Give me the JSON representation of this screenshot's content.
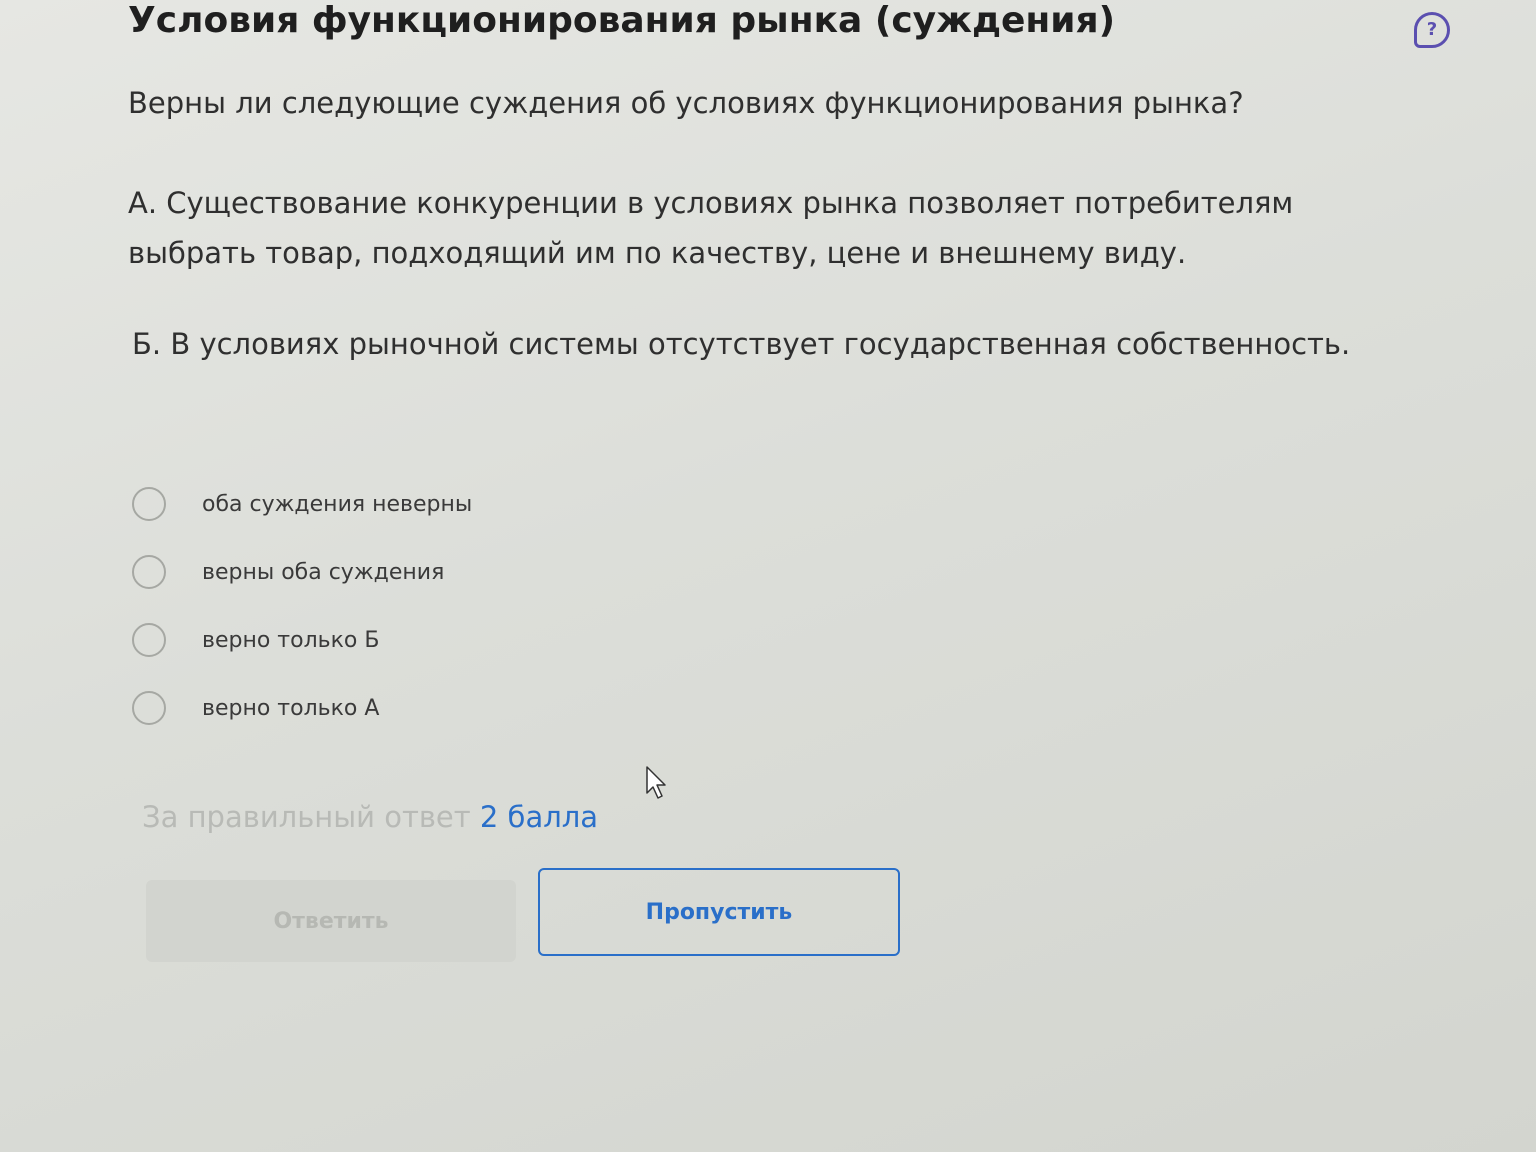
{
  "header": {
    "title": "Условия функционирования рынка (суждения)",
    "help_icon": "question-bubble-icon",
    "help_glyph": "?"
  },
  "task": {
    "question": "Верны ли следующие суждения об условиях функционирования рынка?",
    "statement_a": "А. Существование конкуренции в условиях рынка позволяет потребителям выбрать товар, подходящий им по качеству, цене и внешнему виду.",
    "statement_b": "Б. В условиях рыночной системы отсутствует государственная собственность."
  },
  "options": [
    {
      "label": "оба суждения неверны",
      "selected": false
    },
    {
      "label": "верны оба суждения",
      "selected": false
    },
    {
      "label": "верно только Б",
      "selected": false
    },
    {
      "label": "верно только А",
      "selected": false
    }
  ],
  "score": {
    "prefix": "За правильный ответ",
    "value": "2 балла"
  },
  "actions": {
    "answer_label": "Ответить",
    "answer_enabled": false,
    "skip_label": "Пропустить"
  },
  "colors": {
    "accent": "#2a6fc9",
    "help": "#5b4fb0",
    "disabled_text": "#b6b8b3"
  },
  "icons": {
    "cursor": "mouse-pointer-icon"
  }
}
